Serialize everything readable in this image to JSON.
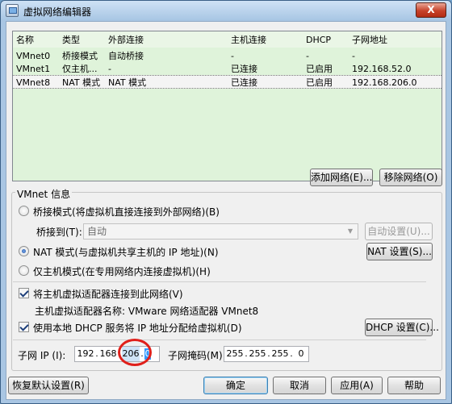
{
  "window": {
    "title": "虚拟网络编辑器",
    "close_label": "X"
  },
  "table": {
    "headers": [
      "名称",
      "类型",
      "外部连接",
      "主机连接",
      "DHCP",
      "子网地址"
    ],
    "rows": [
      [
        "VMnet0",
        "桥接模式",
        "自动桥接",
        "-",
        "-",
        "-"
      ],
      [
        "VMnet1",
        "仅主机...",
        "-",
        "已连接",
        "已启用",
        "192.168.52.0"
      ],
      [
        "VMnet8",
        "NAT 模式",
        "NAT 模式",
        "已连接",
        "已启用",
        "192.168.206.0"
      ]
    ],
    "selected_row": 2
  },
  "buttons": {
    "add_network": "添加网络(E)...",
    "remove_network": "移除网络(O)",
    "auto_settings": "自动设置(U)...",
    "nat_settings": "NAT 设置(S)...",
    "dhcp_settings": "DHCP 设置(C)...",
    "restore_defaults": "恢复默认设置(R)",
    "ok": "确定",
    "cancel": "取消",
    "apply": "应用(A)",
    "help": "帮助"
  },
  "vmnet_info": {
    "group_label": "VMnet 信息",
    "bridged_label": "桥接模式(将虚拟机直接连接到外部网络)(B)",
    "bridge_to_label": "桥接到(T):",
    "bridge_to_value": "自动",
    "nat_label": "NAT 模式(与虚拟机共享主机的 IP 地址)(N)",
    "host_only_label": "仅主机模式(在专用网络内连接虚拟机)(H)",
    "selected_mode": "nat",
    "connect_adapter_label": "将主机虚拟适配器连接到此网络(V)",
    "connect_adapter_checked": true,
    "adapter_name_label": "主机虚拟适配器名称: VMware 网络适配器 VMnet8",
    "use_dhcp_label": "使用本地 DHCP 服务将 IP 地址分配给虚拟机(D)",
    "use_dhcp_checked": true
  },
  "subnet": {
    "ip_label": "子网 IP (I):",
    "ip_octets": [
      "192",
      "168",
      "206",
      "0"
    ],
    "mask_label": "子网掩码(M):",
    "mask_octets": [
      "255",
      "255",
      "255",
      "0"
    ]
  },
  "colors": {
    "table_bg": "#dff3da",
    "highlight_circle": "#e0201b",
    "selection": "#3399ff"
  }
}
